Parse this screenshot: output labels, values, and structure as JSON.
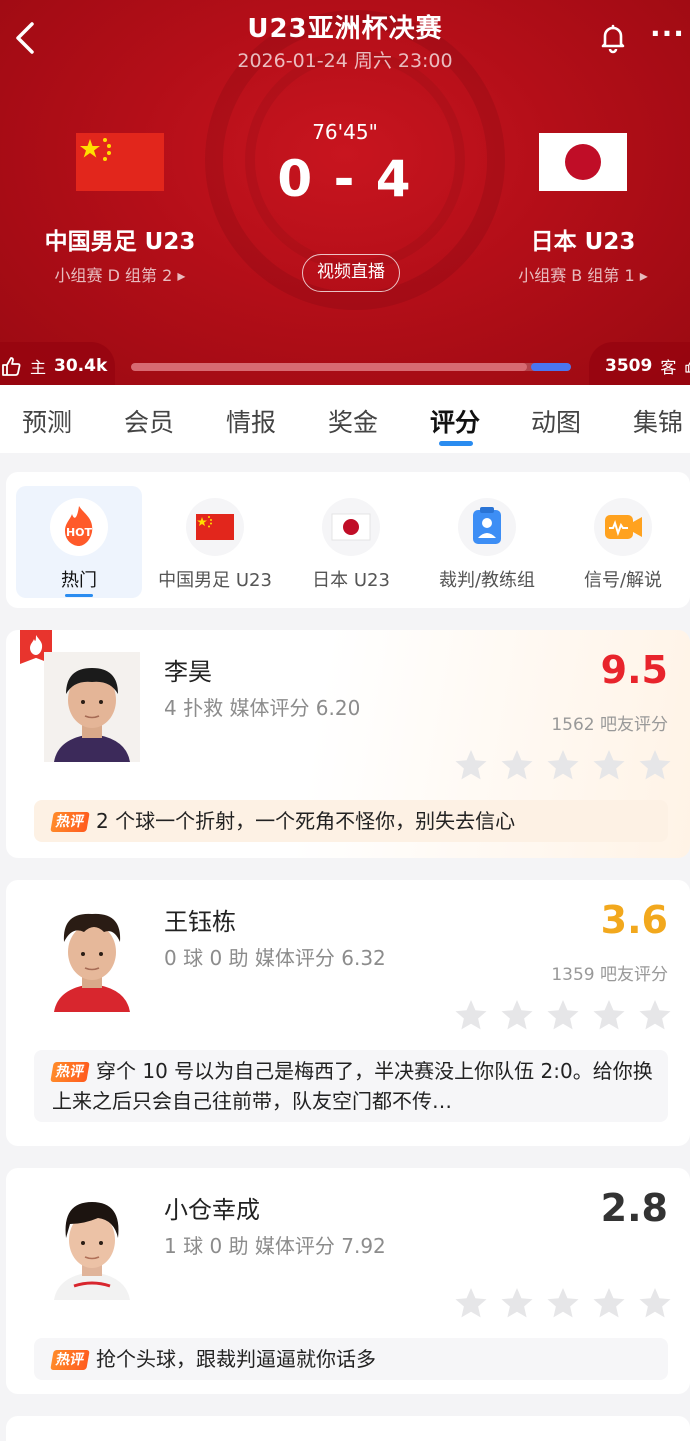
{
  "header": {
    "title": "U23亚洲杯决赛",
    "datetime": "2026-01-24 周六 23:00",
    "match_time": "76'45\"",
    "score": "0 - 4",
    "live_label": "视频直播",
    "home": {
      "name": "中国男足 U23",
      "group": "小组赛 D 组第 2 ▸"
    },
    "away": {
      "name": "日本 U23",
      "group": "小组赛 B 组第 1 ▸"
    },
    "home_vote": {
      "label": "主",
      "count": "30.4k"
    },
    "away_vote": {
      "label": "客",
      "count": "3509"
    },
    "home_vote_share": 0.9
  },
  "tabs": [
    "预测",
    "会员",
    "情报",
    "奖金",
    "评分",
    "动图",
    "集锦"
  ],
  "active_tab": "评分",
  "filters": [
    {
      "label": "热门",
      "icon": "hot-icon"
    },
    {
      "label": "中国男足 U23",
      "icon": "china-flag-icon"
    },
    {
      "label": "日本 U23",
      "icon": "japan-flag-icon"
    },
    {
      "label": "裁判/教练组",
      "icon": "referee-icon"
    },
    {
      "label": "信号/解说",
      "icon": "camera-icon"
    }
  ],
  "players": [
    {
      "name": "李昊",
      "stat": "4 扑救   媒体评分 6.20",
      "rating": "9.5",
      "rating_color": "#e8242c",
      "fan_count": "1562 吧友评分",
      "hot_tag": "热评",
      "comment": "2 个球一个折射，一个死角不怪你，别失去信心"
    },
    {
      "name": "王钰栋",
      "stat": "0 球  0 助   媒体评分 6.32",
      "rating": "3.6",
      "rating_color": "#f2a81d",
      "fan_count": "1359 吧友评分",
      "hot_tag": "热评",
      "comment": "穿个 10 号以为自己是梅西了，半决赛没上你队伍 2:0。给你换上来之后只会自己往前带，队友空门都不传…"
    },
    {
      "name": "小仓幸成",
      "stat": "1 球  0 助   媒体评分 7.92",
      "rating": "2.8",
      "rating_color": "#333333",
      "fan_count": "",
      "hot_tag": "热评",
      "comment": "抢个头球，跟裁判逼逼就你话多"
    }
  ]
}
